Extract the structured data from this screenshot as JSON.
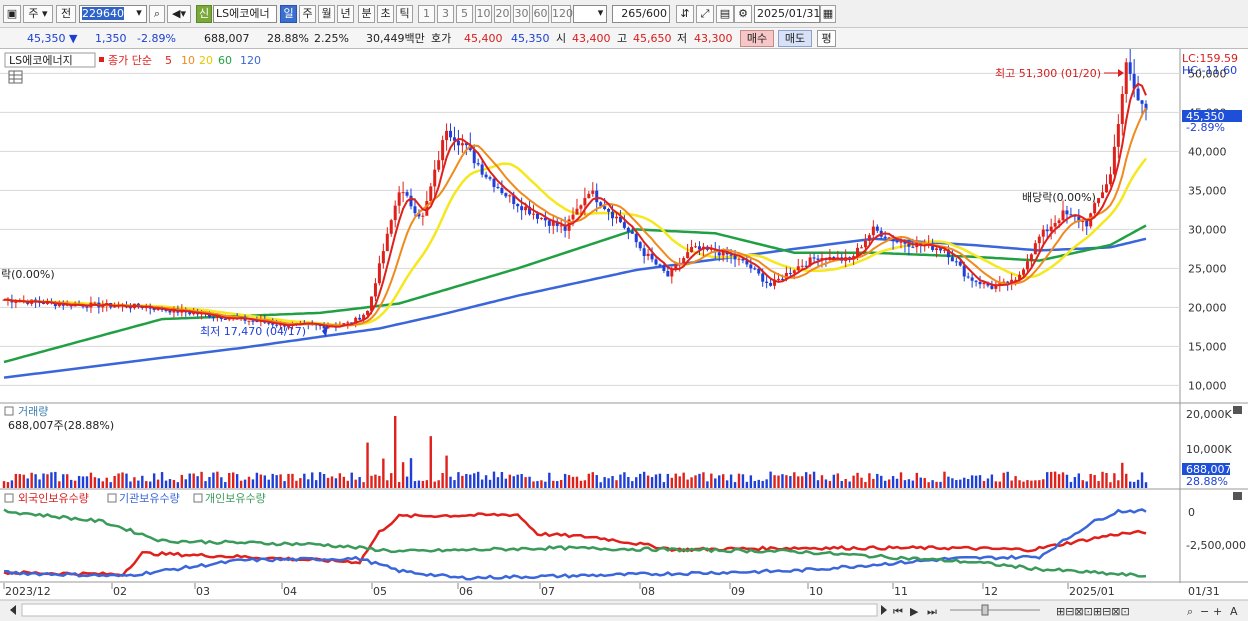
{
  "toolbar": {
    "period_label": "주",
    "prev_label": "전",
    "stock_code": "229640",
    "new_badge": "신",
    "stock_name": "LS에코에너",
    "period_tabs": [
      "일",
      "주",
      "월",
      "년",
      "분",
      "초",
      "틱"
    ],
    "interval_buttons": [
      "1",
      "3",
      "5",
      "10",
      "20",
      "30",
      "60",
      "120"
    ],
    "count_value": "265",
    "count_total": "/600",
    "date_value": "2025/01/31"
  },
  "quote": {
    "price": "45,350",
    "change": "1,350",
    "change_rate": "-2.89%",
    "volume": "688,007",
    "volume_rate": "28.88%",
    "turnover_rate": "2.25%",
    "amount": "30,449백만",
    "bid_label": "호가",
    "ask_price": "45,400",
    "bid_price": "45,350",
    "open_label": "시",
    "open": "43,400",
    "high_label": "고",
    "high": "45,650",
    "low_label": "저",
    "low": "43,300",
    "buy_label": "매수",
    "sell_label": "매도",
    "eval_label": "평"
  },
  "price_panel": {
    "legend_name": "LS에코에너지",
    "legend_series_label": "종가 단순",
    "ma_periods": [
      "5",
      "10",
      "20",
      "60",
      "120"
    ],
    "lc_label": "LC:159.59",
    "hc_label": "HC:-11.60",
    "current_price_tag": "45,350",
    "current_rate_tag": "-2.89%",
    "y_ticks": [
      "50,000",
      "45,000",
      "40,000",
      "35,000",
      "30,000",
      "25,000",
      "20,000",
      "15,000",
      "10,000"
    ],
    "high_annotation": "최고 51,300 (01/20)",
    "low_annotation": "최저 17,470 (04/17)",
    "dividend_annotation": "배당락(0.00%)",
    "left_annotation": "락(0.00%)"
  },
  "volume_panel": {
    "title": "거래량",
    "value_text": "688,007주(28.88%)",
    "y_ticks": [
      "20,000K",
      "10,000K"
    ],
    "tag_value": "688,007",
    "tag_rate": "28.88%"
  },
  "holding_panel": {
    "legend": [
      "외국인보유수량",
      "기관보유수량",
      "개인보유수량"
    ],
    "y_ticks": [
      "0",
      "-2,500,000"
    ]
  },
  "x_axis": {
    "labels": [
      "2023/12",
      "02",
      "03",
      "04",
      "05",
      "06",
      "07",
      "08",
      "09",
      "10",
      "11",
      "12",
      "2025/01"
    ],
    "right_label": "01/31"
  },
  "colors": {
    "up": "#e0201b",
    "down": "#1e3fd8",
    "ma5": "#e0201b",
    "ma10": "#f08a1c",
    "ma20": "#f5e81e",
    "ma60": "#21a043",
    "ma120": "#3a66d9",
    "foreign": "#e0201b",
    "institution": "#3a66d9",
    "individual": "#3a9a5a"
  },
  "chart_data": {
    "type": "line",
    "title": "LS에코에너지",
    "x": [
      "2023/12",
      "02",
      "03",
      "04",
      "05",
      "06",
      "07",
      "08",
      "09",
      "10",
      "11",
      "12",
      "2025/01",
      "01/31"
    ],
    "series": [
      {
        "name": "종가 단순 5",
        "values": [
          21000,
          20000,
          19000,
          17700,
          19500,
          41000,
          30500,
          26500,
          23500,
          28500,
          23500,
          26000,
          51000,
          45350
        ]
      },
      {
        "name": "120",
        "values": [
          11000,
          13500,
          15500,
          16800,
          17800,
          21000,
          24500,
          26000,
          27000,
          28200,
          28500,
          27500,
          27600,
          28800
        ]
      }
    ],
    "ylim": [
      8000,
      53000
    ],
    "highest": "최고 51,300 (01/20)",
    "lowest": "최저 17,470 (04/17)"
  }
}
